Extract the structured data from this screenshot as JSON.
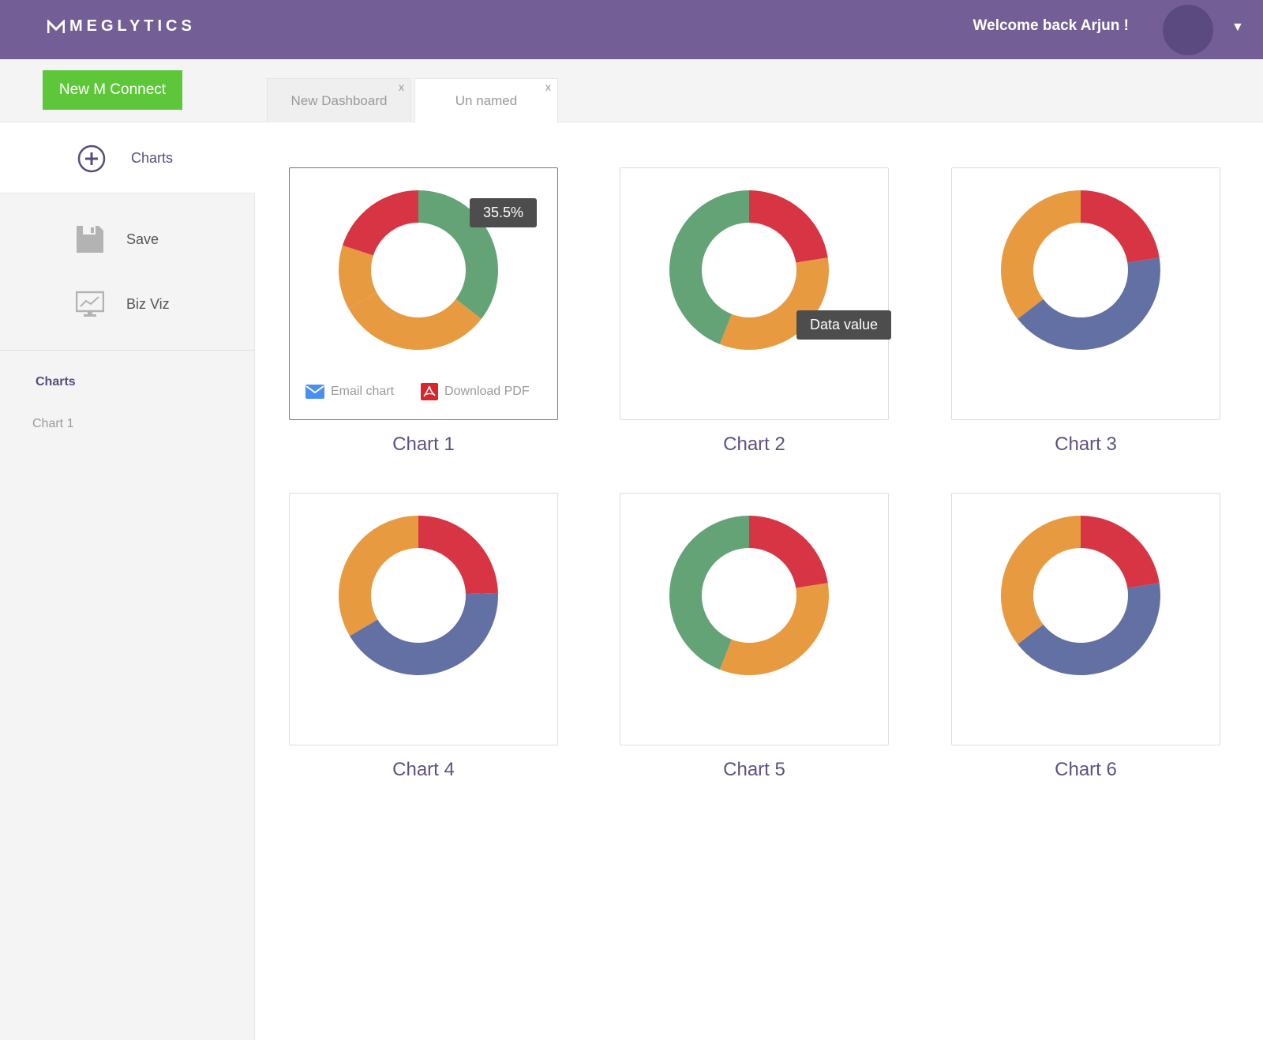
{
  "header": {
    "logo_text": "MEGLYTICS",
    "welcome": "Welcome back Arjun !",
    "dropdown_icon": "caret-down-icon"
  },
  "toolbar": {
    "new_connect_label": "New M Connect"
  },
  "tabs": [
    {
      "label": "New Dashboard",
      "close": "x"
    },
    {
      "label": "Un named",
      "close": "x"
    }
  ],
  "sidebar": {
    "charts_label": "Charts",
    "save_label": "Save",
    "bizviz_label": "Biz Viz",
    "section_heading": "Charts",
    "items": [
      {
        "label": "Chart 1"
      }
    ]
  },
  "colors": {
    "brand": "#735f96",
    "green_button": "#5ec639",
    "red": "#d83544",
    "green": "#63a376",
    "orange": "#e89a41",
    "blue": "#6370a3"
  },
  "card_actions": {
    "email_label": "Email chart",
    "pdf_label": "Download PDF"
  },
  "chart_data": [
    {
      "type": "pie",
      "title": "Chart 1",
      "segments": [
        {
          "value": 35.5,
          "color": "#63a376"
        },
        {
          "value": 31.5,
          "color": "#e89a41"
        },
        {
          "value": 13,
          "color": "#e89a41"
        },
        {
          "value": 20,
          "color": "#d83544"
        }
      ],
      "tooltip": "35.5%",
      "active": true
    },
    {
      "type": "pie",
      "title": "Chart 2",
      "segments": [
        {
          "value": 22.5,
          "color": "#d83544"
        },
        {
          "value": 33.5,
          "color": "#e89a41"
        },
        {
          "value": 44,
          "color": "#63a376"
        }
      ],
      "tooltip": "Data value"
    },
    {
      "type": "pie",
      "title": "Chart 3",
      "segments": [
        {
          "value": 22.5,
          "color": "#d83544"
        },
        {
          "value": 42,
          "color": "#6370a3"
        },
        {
          "value": 35.5,
          "color": "#e89a41"
        }
      ]
    },
    {
      "type": "pie",
      "title": "Chart 4",
      "segments": [
        {
          "value": 24.5,
          "color": "#d83544"
        },
        {
          "value": 42,
          "color": "#6370a3"
        },
        {
          "value": 33.5,
          "color": "#e89a41"
        }
      ]
    },
    {
      "type": "pie",
      "title": "Chart 5",
      "segments": [
        {
          "value": 22.5,
          "color": "#d83544"
        },
        {
          "value": 33.5,
          "color": "#e89a41"
        },
        {
          "value": 44,
          "color": "#63a376"
        }
      ]
    },
    {
      "type": "pie",
      "title": "Chart 6",
      "segments": [
        {
          "value": 22.5,
          "color": "#d83544"
        },
        {
          "value": 42,
          "color": "#6370a3"
        },
        {
          "value": 35.5,
          "color": "#e89a41"
        }
      ]
    }
  ]
}
